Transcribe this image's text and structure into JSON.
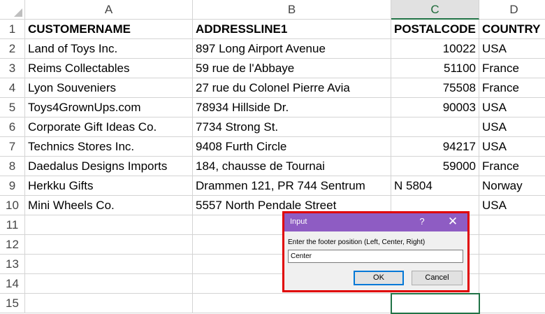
{
  "spreadsheet": {
    "columns": [
      "A",
      "B",
      "C",
      "D"
    ],
    "selected_column": "C",
    "rows": [
      "1",
      "2",
      "3",
      "4",
      "5",
      "6",
      "7",
      "8",
      "9",
      "10",
      "11",
      "12",
      "13",
      "14",
      "15"
    ],
    "header": [
      "CUSTOMERNAME",
      "ADDRESSLINE1",
      "POSTALCODE",
      "COUNTRY"
    ],
    "data": [
      [
        "Land of Toys Inc.",
        "897 Long Airport Avenue",
        "10022",
        "USA"
      ],
      [
        "Reims Collectables",
        "59 rue de l'Abbaye",
        "51100",
        "France"
      ],
      [
        "Lyon Souveniers",
        "27 rue du Colonel Pierre Avia",
        "75508",
        "France"
      ],
      [
        "Toys4GrownUps.com",
        "78934 Hillside Dr.",
        "90003",
        "USA"
      ],
      [
        "Corporate Gift Ideas Co.",
        "7734 Strong St.",
        "",
        "USA"
      ],
      [
        "Technics Stores Inc.",
        "9408 Furth Circle",
        "94217",
        "USA"
      ],
      [
        "Daedalus Designs Imports",
        "184, chausse de Tournai",
        "59000",
        "France"
      ],
      [
        "Herkku Gifts",
        "Drammen 121, PR 744 Sentrum",
        "N 5804",
        "Norway"
      ],
      [
        "Mini Wheels Co.",
        "5557 North Pendale Street",
        "",
        "USA"
      ]
    ]
  },
  "dialog": {
    "title": "Input",
    "help_glyph": "?",
    "close_glyph": "✕",
    "prompt": "Enter the footer position (Left, Center, Right)",
    "input_value": "Center",
    "ok_label": "OK",
    "cancel_label": "Cancel"
  },
  "colors": {
    "dialog_title_bar": "#8e5cc3",
    "highlight_outline": "#e00000",
    "selection_green": "#217346"
  }
}
